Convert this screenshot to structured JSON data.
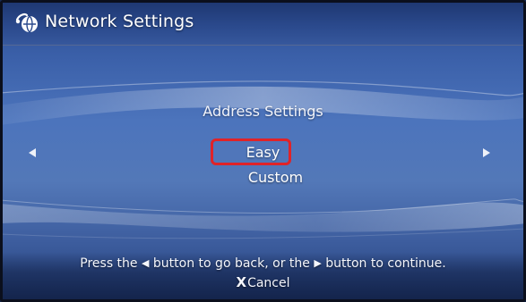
{
  "header": {
    "icon": "network-globe-icon",
    "title": "Network Settings"
  },
  "main": {
    "subtitle": "Address Settings",
    "options": [
      {
        "label": "Easy",
        "selected": true
      },
      {
        "label": "Custom",
        "selected": false
      }
    ],
    "left_arrow_icon": "left-triangle-icon",
    "right_arrow_icon": "right-triangle-icon",
    "highlight_color": "#e02328"
  },
  "footer": {
    "hint_part1": "Press the",
    "hint_part2": "button to go back, or the",
    "hint_part3": "button to continue.",
    "cancel_glyph": "X",
    "cancel_label": "Cancel"
  }
}
